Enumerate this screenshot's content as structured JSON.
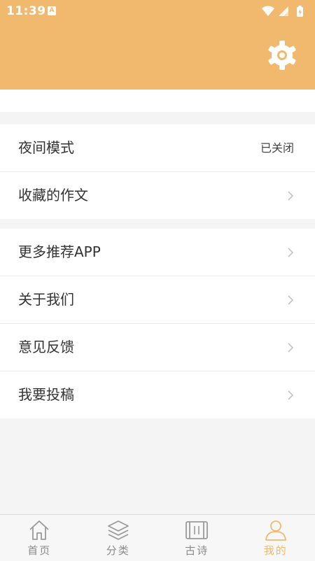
{
  "status_bar": {
    "time": "11:39",
    "notification_badge": "A"
  },
  "colors": {
    "accent": "#f0b96d",
    "text": "#333333",
    "tab_inactive": "#8a8a8a"
  },
  "header": {
    "settings_icon": "gear-icon"
  },
  "group1": {
    "night_mode_label": "夜间模式",
    "night_mode_value": "已关闭",
    "favorites_label": "收藏的作文"
  },
  "group2": {
    "items": [
      {
        "label": "更多推荐APP"
      },
      {
        "label": "关于我们"
      },
      {
        "label": "意见反馈"
      },
      {
        "label": "我要投稿"
      }
    ]
  },
  "tabbar": {
    "tabs": [
      {
        "label": "首页",
        "icon": "home-icon"
      },
      {
        "label": "分类",
        "icon": "layers-icon"
      },
      {
        "label": "古诗",
        "icon": "scroll-icon"
      },
      {
        "label": "我的",
        "icon": "user-icon"
      }
    ],
    "active_index": 3
  }
}
